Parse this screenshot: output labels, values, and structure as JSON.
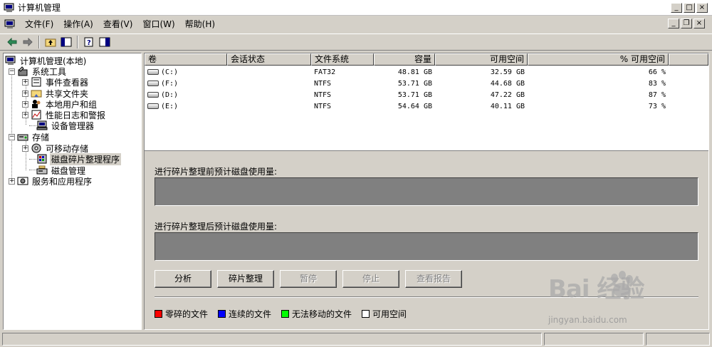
{
  "window": {
    "title": "计算机管理"
  },
  "menu": {
    "items": [
      {
        "label": "文件(F)"
      },
      {
        "label": "操作(A)"
      },
      {
        "label": "查看(V)"
      },
      {
        "label": "窗口(W)"
      },
      {
        "label": "帮助(H)"
      }
    ]
  },
  "tree": {
    "root": "计算机管理(本地)",
    "items": [
      {
        "label": "系统工具"
      },
      {
        "label": "事件查看器"
      },
      {
        "label": "共享文件夹"
      },
      {
        "label": "本地用户和组"
      },
      {
        "label": "性能日志和警报"
      },
      {
        "label": "设备管理器"
      },
      {
        "label": "存储"
      },
      {
        "label": "可移动存储"
      },
      {
        "label": "磁盘碎片整理程序"
      },
      {
        "label": "磁盘管理"
      },
      {
        "label": "服务和应用程序"
      }
    ]
  },
  "volumes": {
    "headers": [
      "卷",
      "会话状态",
      "文件系统",
      "容量",
      "可用空间",
      "% 可用空间"
    ],
    "rows": [
      {
        "volume": "(C:)",
        "status": "",
        "fs": "FAT32",
        "capacity": "48.81 GB",
        "free": "32.59 GB",
        "pct": "66 %"
      },
      {
        "volume": "(F:)",
        "status": "",
        "fs": "NTFS",
        "capacity": "53.71 GB",
        "free": "44.68 GB",
        "pct": "83 %"
      },
      {
        "volume": "(D:)",
        "status": "",
        "fs": "NTFS",
        "capacity": "53.71 GB",
        "free": "47.22 GB",
        "pct": "87 %"
      },
      {
        "volume": "(E:)",
        "status": "",
        "fs": "NTFS",
        "capacity": "54.64 GB",
        "free": "40.11 GB",
        "pct": "73 %"
      }
    ]
  },
  "defrag": {
    "before_label": "进行碎片整理前预计磁盘使用量:",
    "after_label": "进行碎片整理后预计磁盘使用量:",
    "buttons": {
      "analyze": "分析",
      "defragment": "碎片整理",
      "pause": "暂停",
      "stop": "停止",
      "report": "查看报告"
    },
    "legend": [
      {
        "label": "零碎的文件",
        "color": "#ff0000"
      },
      {
        "label": "连续的文件",
        "color": "#0000ff"
      },
      {
        "label": "无法移动的文件",
        "color": "#00ff00"
      },
      {
        "label": "可用空间",
        "color": "#ffffff"
      }
    ]
  },
  "watermark": {
    "brand": "Bai  经验",
    "url": "jingyan.baidu.com"
  }
}
